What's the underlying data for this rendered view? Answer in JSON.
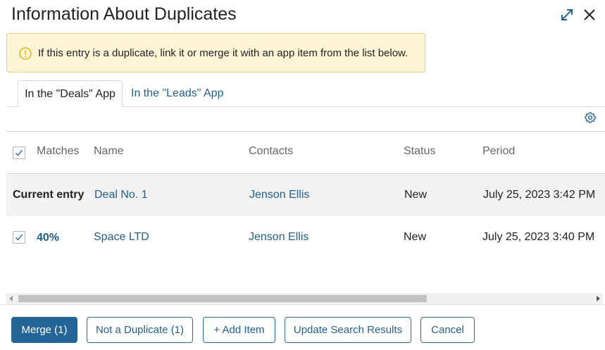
{
  "dialog": {
    "title": "Information About Duplicates"
  },
  "alert": {
    "text": "If this entry is a duplicate, link it or merge it with an app item from the list below."
  },
  "tabs": [
    {
      "label": "In the \"Deals\" App",
      "active": true
    },
    {
      "label": "In the \"Leads\" App",
      "active": false
    }
  ],
  "table": {
    "headers": {
      "matches": "Matches",
      "name": "Name",
      "contacts": "Contacts",
      "status": "Status",
      "period": "Period"
    },
    "current_row": {
      "label": "Current entry",
      "name": "Deal No. 1",
      "contact": "Jenson Ellis",
      "status": "New",
      "period": "July 25, 2023 3:42 PM"
    },
    "rows": [
      {
        "checked": true,
        "match": "40%",
        "name": "Space LTD",
        "contact": "Jenson Ellis",
        "status": "New",
        "period": "July 25, 2023 3:40 PM"
      }
    ]
  },
  "footer": {
    "merge": "Merge (1)",
    "not_duplicate": "Not a Duplicate (1)",
    "add_item": "+ Add Item",
    "update": "Update Search Results",
    "cancel": "Cancel"
  },
  "colors": {
    "primary": "#226596",
    "link": "#1f5f8f",
    "alert_bg": "#fdf5d6",
    "alert_icon": "#e5b400"
  }
}
